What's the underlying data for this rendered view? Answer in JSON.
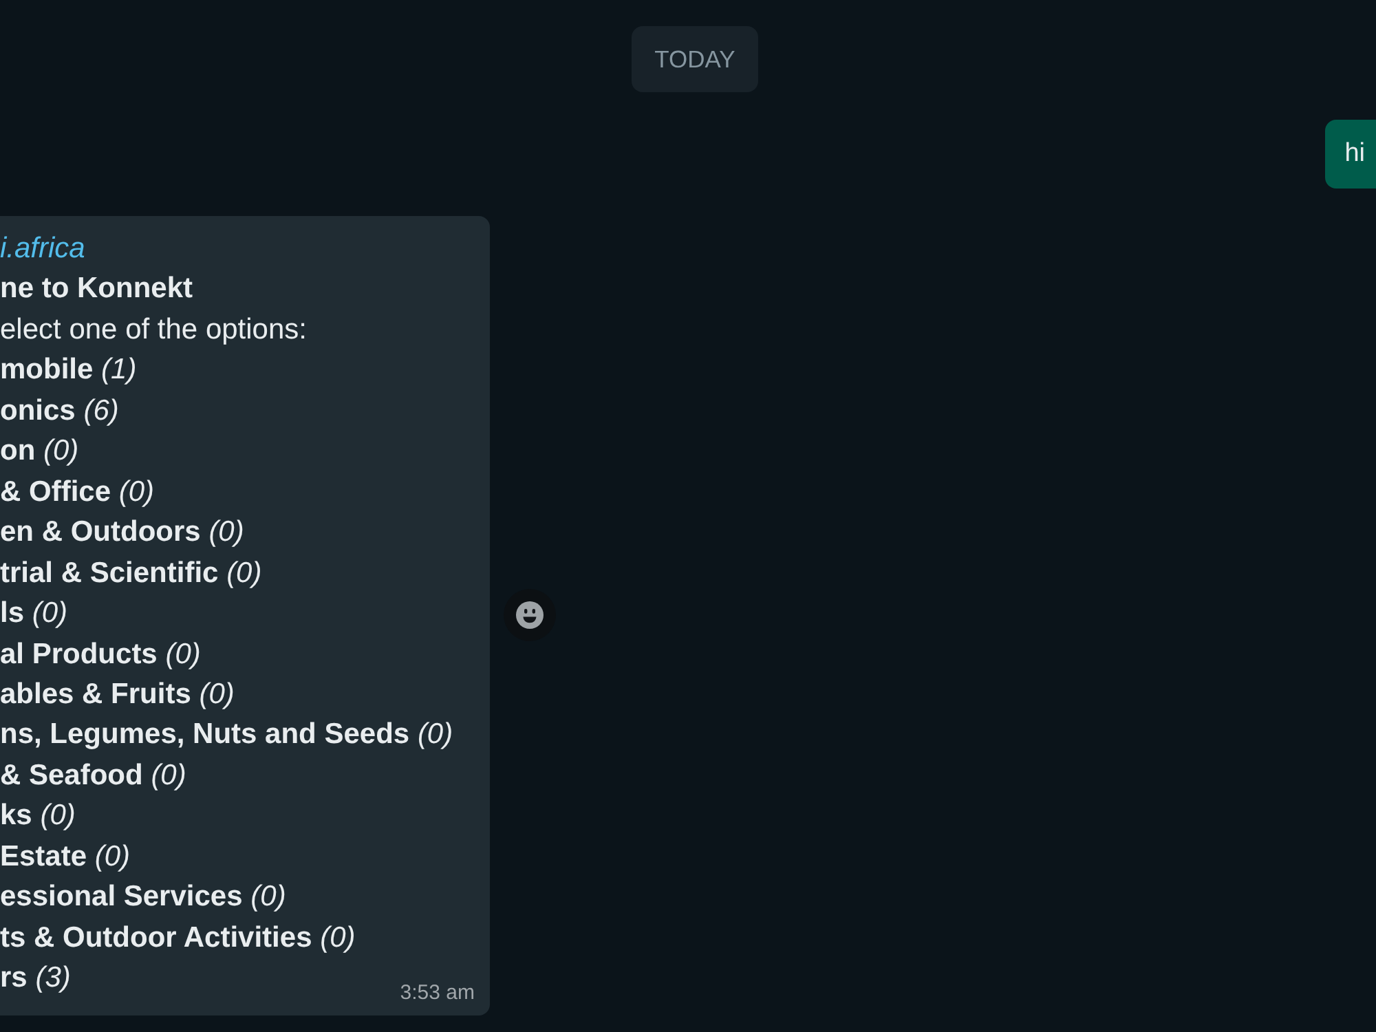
{
  "date_divider": "TODAY",
  "messages": [
    {
      "kind": "outgoing",
      "text": "hi"
    },
    {
      "kind": "incoming",
      "sender": "i.africa",
      "title": "ne to Konnekt",
      "prompt": "elect one of the options:",
      "options": [
        {
          "name": "mobile",
          "count": "(1)"
        },
        {
          "name": "onics",
          "count": "(6)"
        },
        {
          "name": "on",
          "count": "(0)"
        },
        {
          "name": "& Office",
          "count": "(0)"
        },
        {
          "name": "en & Outdoors",
          "count": "(0)"
        },
        {
          "name": "trial & Scientific",
          "count": "(0)"
        },
        {
          "name": "ls",
          "count": "(0)"
        },
        {
          "name": "al Products",
          "count": "(0)"
        },
        {
          "name": "ables & Fruits",
          "count": "(0)"
        },
        {
          "name": "ns, Legumes, Nuts and Seeds",
          "count": "(0)"
        },
        {
          "name": "& Seafood",
          "count": "(0)"
        },
        {
          "name": "ks",
          "count": "(0)"
        },
        {
          "name": "Estate",
          "count": "(0)"
        },
        {
          "name": "essional Services",
          "count": "(0)"
        },
        {
          "name": "ts & Outdoor Activities",
          "count": "(0)"
        },
        {
          "name": "rs",
          "count": "(3)"
        }
      ],
      "time": "3:53 am",
      "reaction_button": true
    }
  ]
}
